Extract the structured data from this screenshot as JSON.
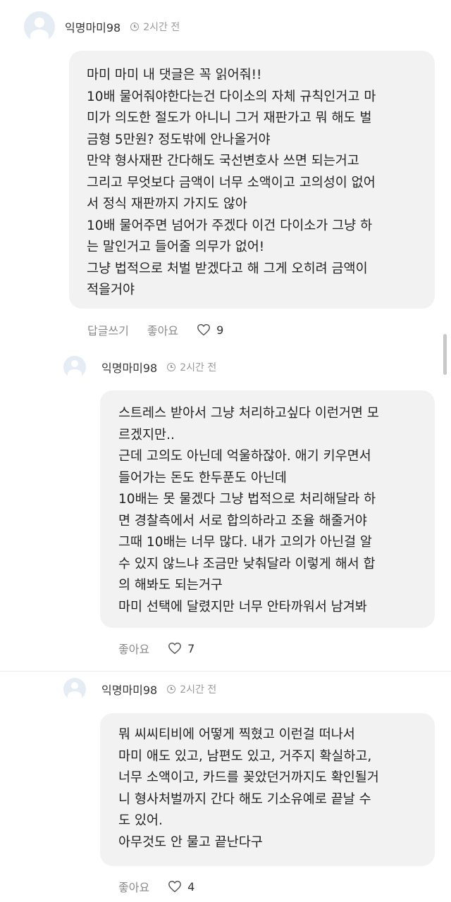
{
  "comments": [
    {
      "author": "익명마미98",
      "time": "2시간 전",
      "lines": [
        "마미 마미 내 댓글은 꼭 읽어줘!!",
        "10배 물어줘야한다는건 다이소의 자체 규칙인거고 마",
        "미가 의도한 절도가 아니니 그거 재판가고 뭐 해도 벌",
        "금형 5만원? 정도밖에 안나올거야",
        "만약 형사재판 간다해도 국선변호사 쓰면 되는거고",
        "그리고 무엇보다 금액이 너무 소액이고 고의성이 없어",
        "서 정식 재판까지 가지도 않아",
        "10배 물어주면 넘어가 주겠다 이건 다이소가 그냥 하",
        "는 말인거고 들어줄 의무가 없어!",
        "그냥 법적으로 처벌 받겠다고 해 그게 오히려 금액이",
        "적을거야"
      ],
      "reply_label": "답글쓰기",
      "like_label": "좋아요",
      "likes": "9"
    },
    {
      "author": "익명마미98",
      "time": "2시간 전",
      "lines": [
        "스트레스 받아서 그냥 처리하고싶다 이런거면 모",
        "르겠지만..",
        "근데 고의도 아닌데 억울하잖아. 애기 키우면서",
        "들어가는 돈도 한두푼도 아닌데",
        "10배는 못 물겠다 그냥 법적으로 처리해달라 하",
        "면 경찰측에서 서로 합의하라고 조율 해줄거야",
        "그때 10배는 너무 많다. 내가 고의가 아닌걸 알",
        "수 있지 않느냐 조금만 낮춰달라 이렇게 해서 합",
        "의 해봐도 되는거구",
        "마미 선택에 달렸지만 너무 안타까워서 남겨봐"
      ],
      "like_label": "좋아요",
      "likes": "7"
    },
    {
      "author": "익명마미98",
      "time": "2시간 전",
      "lines": [
        "뭐 씨씨티비에 어떻게 찍혔고 이런걸 떠나서",
        "마미 애도 있고, 남편도 있고, 거주지 확실하고,",
        "너무 소액이고, 카드를 꽂았던거까지도 확인될거",
        "니 형사처벌까지 간다 해도 기소유예로 끝날 수",
        "도 있어.",
        "아무것도 안 물고 끝난다구"
      ],
      "like_label": "좋아요",
      "likes": "4"
    }
  ]
}
